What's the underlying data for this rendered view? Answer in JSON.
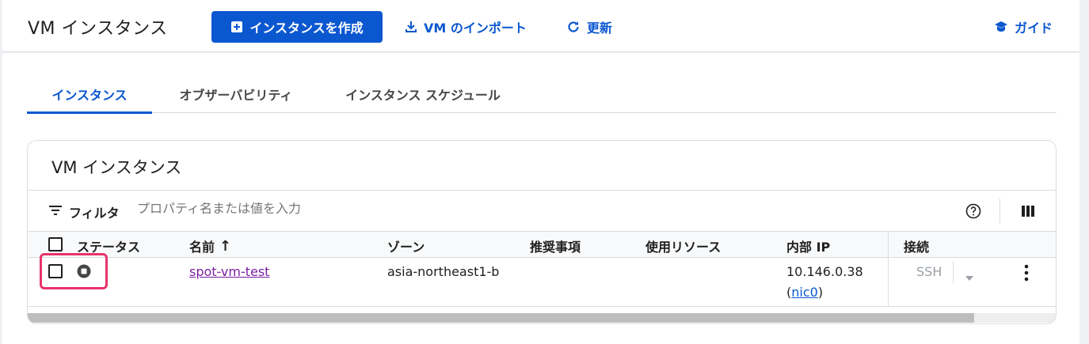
{
  "header": {
    "title": "VM インスタンス",
    "create_label": "インスタンスを作成",
    "import_label": "VM のインポート",
    "refresh_label": "更新",
    "guide_label": "ガイド"
  },
  "tabs": [
    {
      "label": "インスタンス",
      "active": true
    },
    {
      "label": "オブザーバビリティ",
      "active": false
    },
    {
      "label": "インスタンス スケジュール",
      "active": false
    }
  ],
  "card": {
    "title": "VM インスタンス",
    "filter_label": "フィルタ",
    "filter_placeholder": "プロパティ名または値を入力"
  },
  "table": {
    "columns": [
      "ステータス",
      "名前",
      "ゾーン",
      "推奨事項",
      "使用リソース",
      "内部 IP",
      "接続"
    ],
    "sort_indicator": "↑",
    "rows": [
      {
        "name": "spot-vm-test",
        "zone": "asia-northeast1-b",
        "recommendation": "",
        "in_use_by": "",
        "internal_ip": "10.146.0.38",
        "nic_prefix": "(",
        "nic": "nic0",
        "nic_suffix": ")",
        "connect": "SSH"
      }
    ]
  },
  "colors": {
    "accent": "#0b57d0",
    "highlight": "#e8336b",
    "visited_link": "#7b1fa2"
  },
  "icons": [
    "add-box-icon",
    "download-icon",
    "refresh-icon",
    "guide-icon",
    "filter-icon",
    "help-icon",
    "columns-icon",
    "stopped-status-icon",
    "dropdown-icon",
    "more-vert-icon"
  ]
}
